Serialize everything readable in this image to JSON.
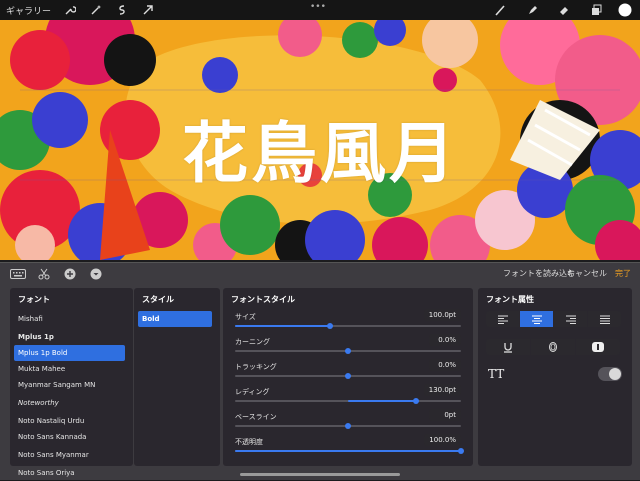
{
  "toolbar": {
    "gallery_label": "ギャラリー",
    "tools_left": [
      "wrench-icon",
      "magic-wand-icon",
      "selection-icon",
      "transform-arrow-icon"
    ],
    "more_label": "•••",
    "tools_right": [
      "brush-icon",
      "smudge-icon",
      "eraser-icon",
      "layers-icon",
      "color-swatch-icon"
    ],
    "color": "#ffffff"
  },
  "canvas": {
    "title_text": "花鳥風月"
  },
  "panel": {
    "actions": {
      "import_fonts": "フォントを読み込む",
      "cancel": "キャンセル",
      "done": "完了",
      "done_color": "#f0a020"
    },
    "fonts": {
      "header": "フォント",
      "items": [
        {
          "label": "Mishafi",
          "selected": false
        },
        {
          "label": "Mplus 1p",
          "selected": false,
          "bold": true
        },
        {
          "label": "Mplus 1p Bold",
          "selected": true
        },
        {
          "label": "Mukta Mahee",
          "selected": false
        },
        {
          "label": "Myanmar Sangam MN",
          "selected": false
        },
        {
          "label": "Noteworthy",
          "selected": false
        },
        {
          "label": "Noto Nastaliq Urdu",
          "selected": false
        },
        {
          "label": "Noto Sans Kannada",
          "selected": false
        },
        {
          "label": "Noto Sans Myanmar",
          "selected": false
        },
        {
          "label": "Noto Sans Oriya",
          "selected": false
        }
      ]
    },
    "styles": {
      "header": "スタイル",
      "selected": "Bold"
    },
    "font_style": {
      "header": "フォントスタイル",
      "rows": [
        {
          "label": "サイズ",
          "value": "100.0pt",
          "level": 0.42
        },
        {
          "label": "カーニング",
          "value": "0.0%",
          "level": 0.5
        },
        {
          "label": "トラッキング",
          "value": "0.0%",
          "level": 0.5
        },
        {
          "label": "レディング",
          "value": "130.0pt",
          "level": 0.8
        },
        {
          "label": "ベースライン",
          "value": "0pt",
          "level": 0.5
        },
        {
          "label": "不透明度",
          "value": "100.0%",
          "level": 1.0
        }
      ]
    },
    "font_attributes": {
      "header": "フォント属性",
      "alignment_selected": "center",
      "tt_label": "TT",
      "all_caps_on": false
    }
  }
}
